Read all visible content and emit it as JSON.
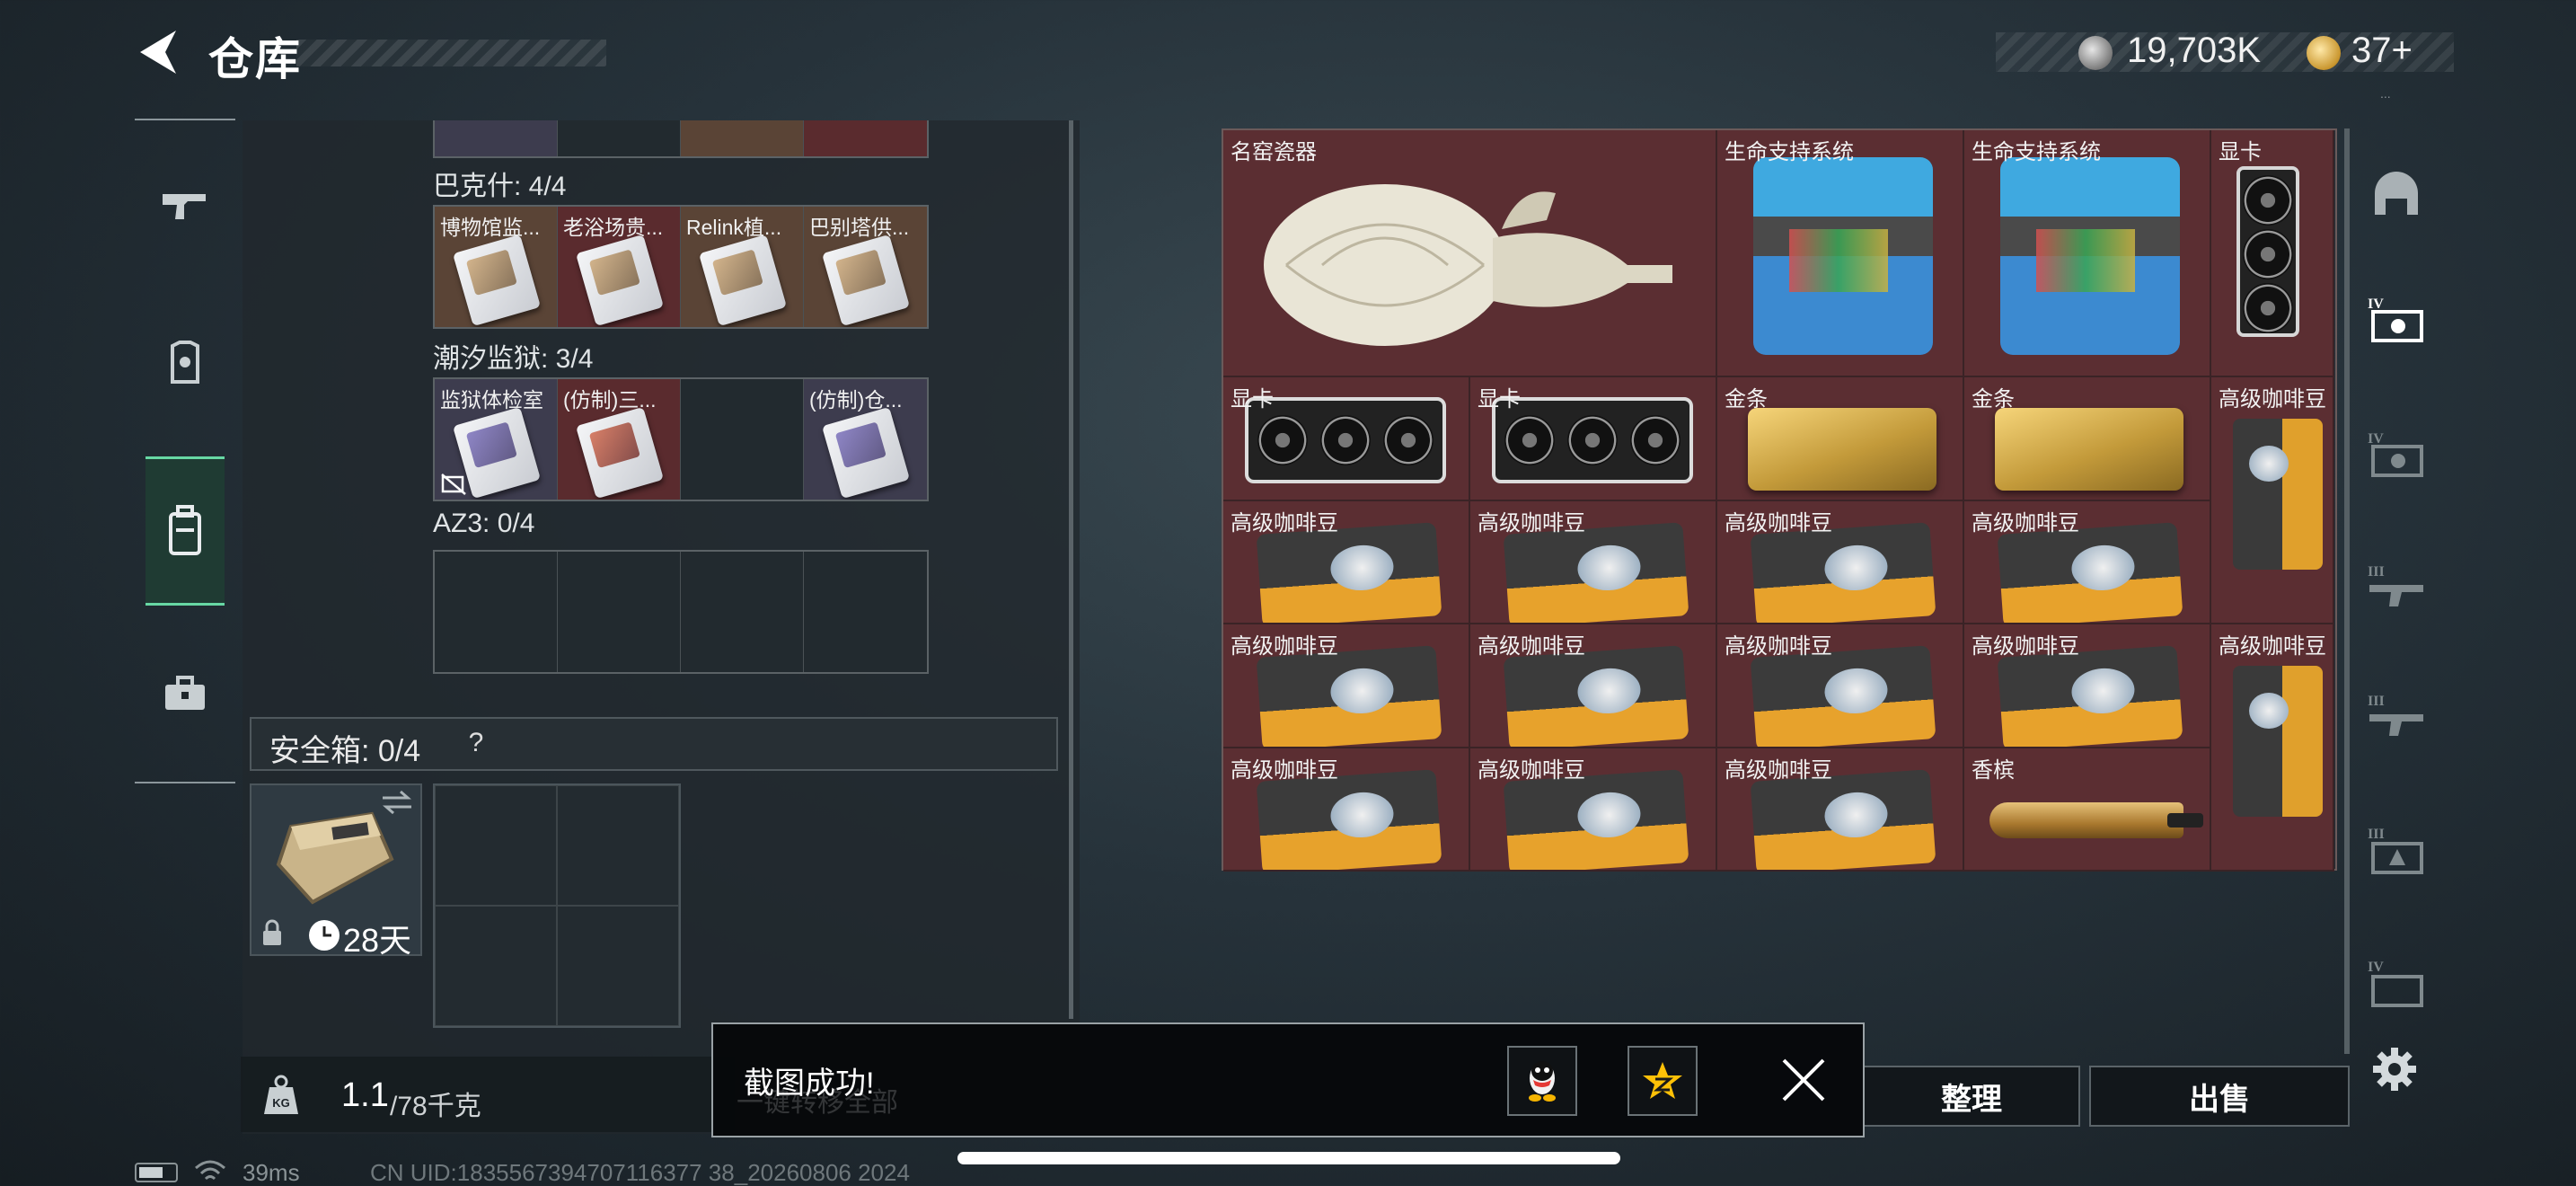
{
  "header": {
    "title": "仓库",
    "currency": [
      {
        "icon": "silver-coin-icon",
        "amount": "19,703K"
      },
      {
        "icon": "gold-coin-icon",
        "amount": "37+"
      }
    ],
    "version_text": "..."
  },
  "left_nav": {
    "items": [
      {
        "icon": "gun-icon",
        "active": false
      },
      {
        "icon": "armor-icon",
        "active": false
      },
      {
        "icon": "backpack-icon",
        "active": true
      },
      {
        "icon": "toolbox-icon",
        "active": false
      }
    ]
  },
  "keycard_groups": [
    {
      "label": "巴克什: 4/4",
      "cells": [
        {
          "name": "博物馆监...",
          "color": "brown",
          "card": "default"
        },
        {
          "name": "老浴场贵...",
          "color": "red",
          "card": "default"
        },
        {
          "name": "Relink植...",
          "color": "brown",
          "card": "default"
        },
        {
          "name": "巴别塔供...",
          "color": "brown",
          "card": "default"
        }
      ]
    },
    {
      "label": "潮汐监狱: 3/4",
      "cells": [
        {
          "name": "监狱体检室",
          "color": "purple",
          "card": "purple",
          "broken": true
        },
        {
          "name": "(仿制)三...",
          "color": "red",
          "card": "red"
        },
        {
          "name": "",
          "color": "empty"
        },
        {
          "name": "(仿制)仓...",
          "color": "purple",
          "card": "purple"
        }
      ]
    },
    {
      "label": "AZ3: 0/4",
      "cells": [
        {
          "name": "",
          "color": "empty"
        },
        {
          "name": "",
          "color": "empty"
        },
        {
          "name": "",
          "color": "empty"
        },
        {
          "name": "",
          "color": "empty"
        }
      ]
    }
  ],
  "safebox": {
    "label": "安全箱: 0/4",
    "help": "?",
    "days": "28天"
  },
  "weight": {
    "current": "1.1",
    "max": "/78千克"
  },
  "stash_items": [
    {
      "name": "名窑瓷器",
      "art": "vase",
      "col": 0,
      "row": 0,
      "w": 2,
      "h": 2
    },
    {
      "name": "生命支持系统",
      "art": "lifesupport",
      "col": 2,
      "row": 0,
      "w": 1,
      "h": 2
    },
    {
      "name": "生命支持系统",
      "art": "lifesupport",
      "col": 3,
      "row": 0,
      "w": 1,
      "h": 2
    },
    {
      "name": "显卡",
      "art": "gpu-v",
      "col": 4,
      "row": 0,
      "w": 0.5,
      "h": 2
    },
    {
      "name": "显卡",
      "art": "gpu-h",
      "col": 0,
      "row": 2,
      "w": 1,
      "h": 1
    },
    {
      "name": "显卡",
      "art": "gpu-h",
      "col": 1,
      "row": 2,
      "w": 1,
      "h": 1
    },
    {
      "name": "金条",
      "art": "goldbar",
      "col": 2,
      "row": 2,
      "w": 1,
      "h": 1
    },
    {
      "name": "金条",
      "art": "goldbar",
      "col": 3,
      "row": 2,
      "w": 1,
      "h": 1
    },
    {
      "name": "高级咖啡豆",
      "art": "coffee-v",
      "col": 4,
      "row": 2,
      "w": 0.5,
      "h": 2
    },
    {
      "name": "高级咖啡豆",
      "art": "coffee-h",
      "col": 0,
      "row": 3,
      "w": 1,
      "h": 1
    },
    {
      "name": "高级咖啡豆",
      "art": "coffee-h",
      "col": 1,
      "row": 3,
      "w": 1,
      "h": 1
    },
    {
      "name": "高级咖啡豆",
      "art": "coffee-h",
      "col": 2,
      "row": 3,
      "w": 1,
      "h": 1
    },
    {
      "name": "高级咖啡豆",
      "art": "coffee-h",
      "col": 3,
      "row": 3,
      "w": 1,
      "h": 1
    },
    {
      "name": "高级咖啡豆",
      "art": "coffee-h",
      "col": 0,
      "row": 4,
      "w": 1,
      "h": 1
    },
    {
      "name": "高级咖啡豆",
      "art": "coffee-h",
      "col": 1,
      "row": 4,
      "w": 1,
      "h": 1
    },
    {
      "name": "高级咖啡豆",
      "art": "coffee-h",
      "col": 2,
      "row": 4,
      "w": 1,
      "h": 1
    },
    {
      "name": "高级咖啡豆",
      "art": "coffee-h",
      "col": 3,
      "row": 4,
      "w": 1,
      "h": 1
    },
    {
      "name": "高级咖啡豆",
      "art": "coffee-v",
      "col": 4,
      "row": 4,
      "w": 0.5,
      "h": 2
    },
    {
      "name": "高级咖啡豆",
      "art": "coffee-h",
      "col": 0,
      "row": 5,
      "w": 1,
      "h": 1
    },
    {
      "name": "高级咖啡豆",
      "art": "coffee-h",
      "col": 1,
      "row": 5,
      "w": 1,
      "h": 1
    },
    {
      "name": "高级咖啡豆",
      "art": "coffee-h",
      "col": 2,
      "row": 5,
      "w": 1,
      "h": 1
    },
    {
      "name": "香槟",
      "art": "champagne",
      "col": 3,
      "row": 5,
      "w": 1,
      "h": 1
    }
  ],
  "category_nav": [
    {
      "icon": "helmet-icon"
    },
    {
      "icon": "tier4-container-icon-a",
      "tier": "IV"
    },
    {
      "icon": "tier4-container-icon-b",
      "tier": "IV"
    },
    {
      "icon": "tier3-rifle-icon-a",
      "tier": "III"
    },
    {
      "icon": "tier3-rifle-icon-b",
      "tier": "III"
    },
    {
      "icon": "tier3-box-icon",
      "tier": "III"
    },
    {
      "icon": "tier4-case-icon",
      "tier": "IV"
    }
  ],
  "actions": {
    "organize": "整理",
    "sell": "出售"
  },
  "toast": {
    "message": "截图成功!",
    "behind_text": "一键转移全部"
  },
  "status": {
    "ping": "39ms",
    "uid": "CN UID:1835567394707116377 38_20260806 2024"
  },
  "colors": {
    "accent_green": "#67d8a4",
    "item_red": "#5b2e32",
    "keycard_brown": "#5a4436",
    "keycard_purple": "#3d3c4e"
  }
}
